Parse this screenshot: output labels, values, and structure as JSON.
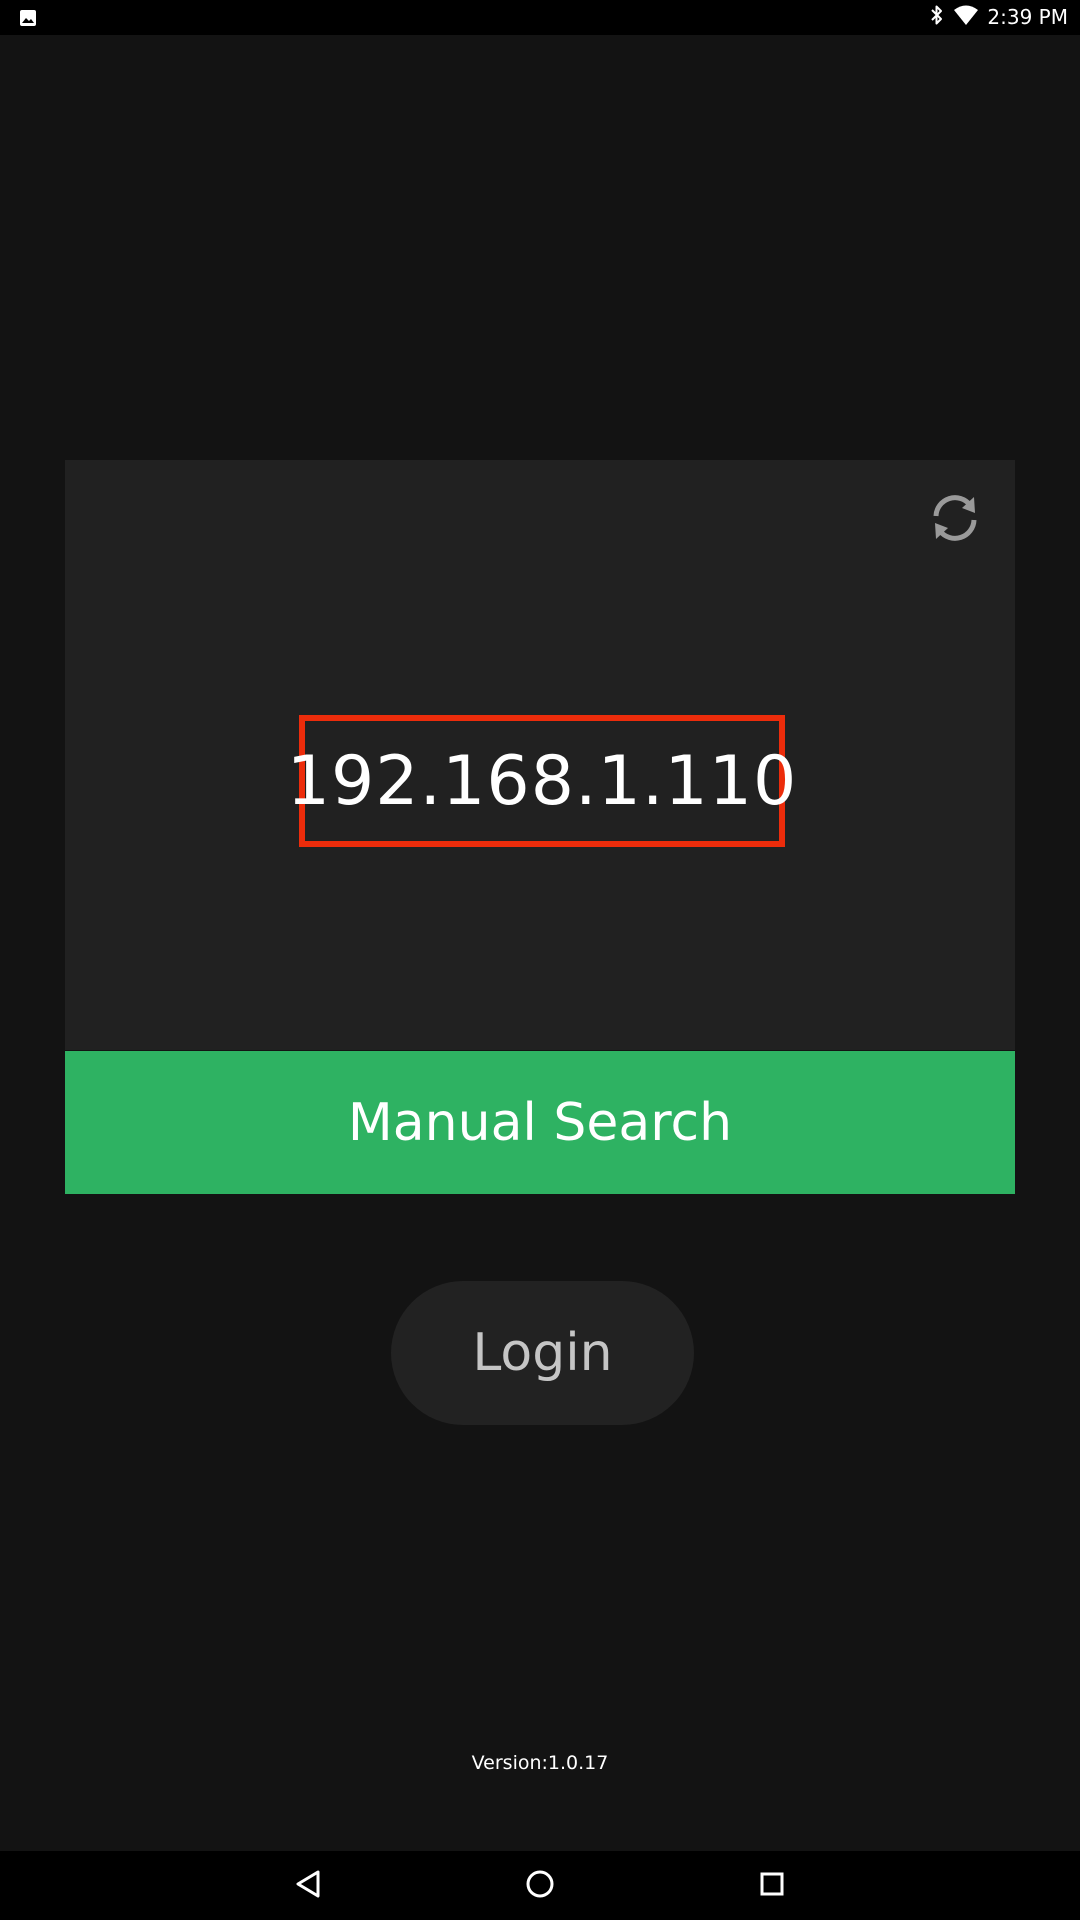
{
  "status_bar": {
    "time": "2:39 PM",
    "left_icon": "image-notification-icon",
    "right_icons": [
      "bluetooth-icon",
      "wifi-icon"
    ]
  },
  "card": {
    "refresh_icon": "refresh-icon",
    "ip_address": "192.168.1.110"
  },
  "buttons": {
    "manual_search_label": "Manual Search",
    "login_label": "Login"
  },
  "footer": {
    "version": "Version:1.0.17"
  },
  "nav_bar": {
    "icons": [
      "back-icon",
      "home-icon",
      "recents-icon"
    ]
  },
  "colors": {
    "background": "#131313",
    "card": "#212121",
    "accent_green": "#2eb262",
    "highlight_red": "#ec2c0b",
    "login_bg": "#222222"
  }
}
